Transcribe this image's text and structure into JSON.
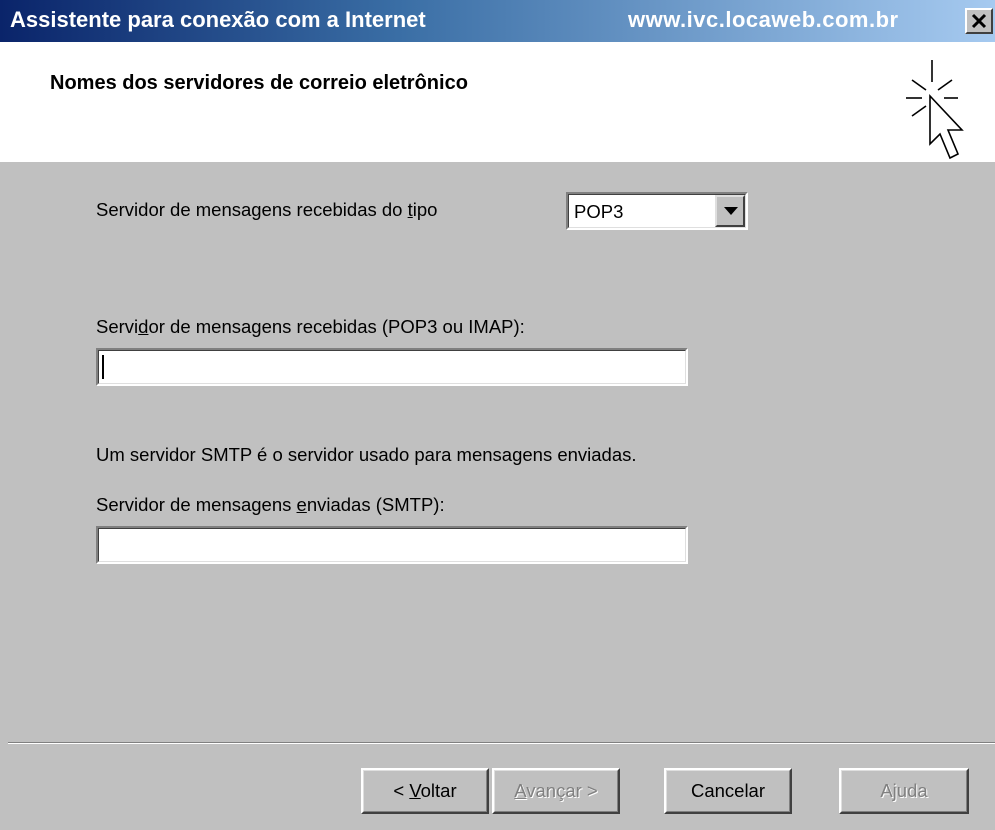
{
  "window": {
    "title": "Assistente para conexão com a Internet",
    "watermark": "www.ivc.locaweb.com.br",
    "close_icon": "close-x-icon"
  },
  "header": {
    "heading": "Nomes dos servidores de correio eletrônico",
    "icon": "wizard-cursor-icon"
  },
  "incoming_type": {
    "label_before": "Servidor de mensagens recebidas do ",
    "label_accel": "t",
    "label_after": "ipo",
    "selected": "POP3"
  },
  "incoming_server": {
    "label_before": "Servi",
    "label_accel": "d",
    "label_after": "or de mensagens recebidas (POP3 ou IMAP):",
    "value": ""
  },
  "smtp_info": "Um servidor SMTP é o servidor usado para mensagens enviadas.",
  "outgoing_server": {
    "label_before": "Servidor de mensagens ",
    "label_accel": "e",
    "label_after": "nviadas (SMTP):",
    "value": ""
  },
  "buttons": {
    "back_before": "< ",
    "back_accel": "V",
    "back_after": "oltar",
    "next_accel": "A",
    "next_after": "vançar >",
    "cancel": "Cancelar",
    "help": "Ajuda"
  }
}
